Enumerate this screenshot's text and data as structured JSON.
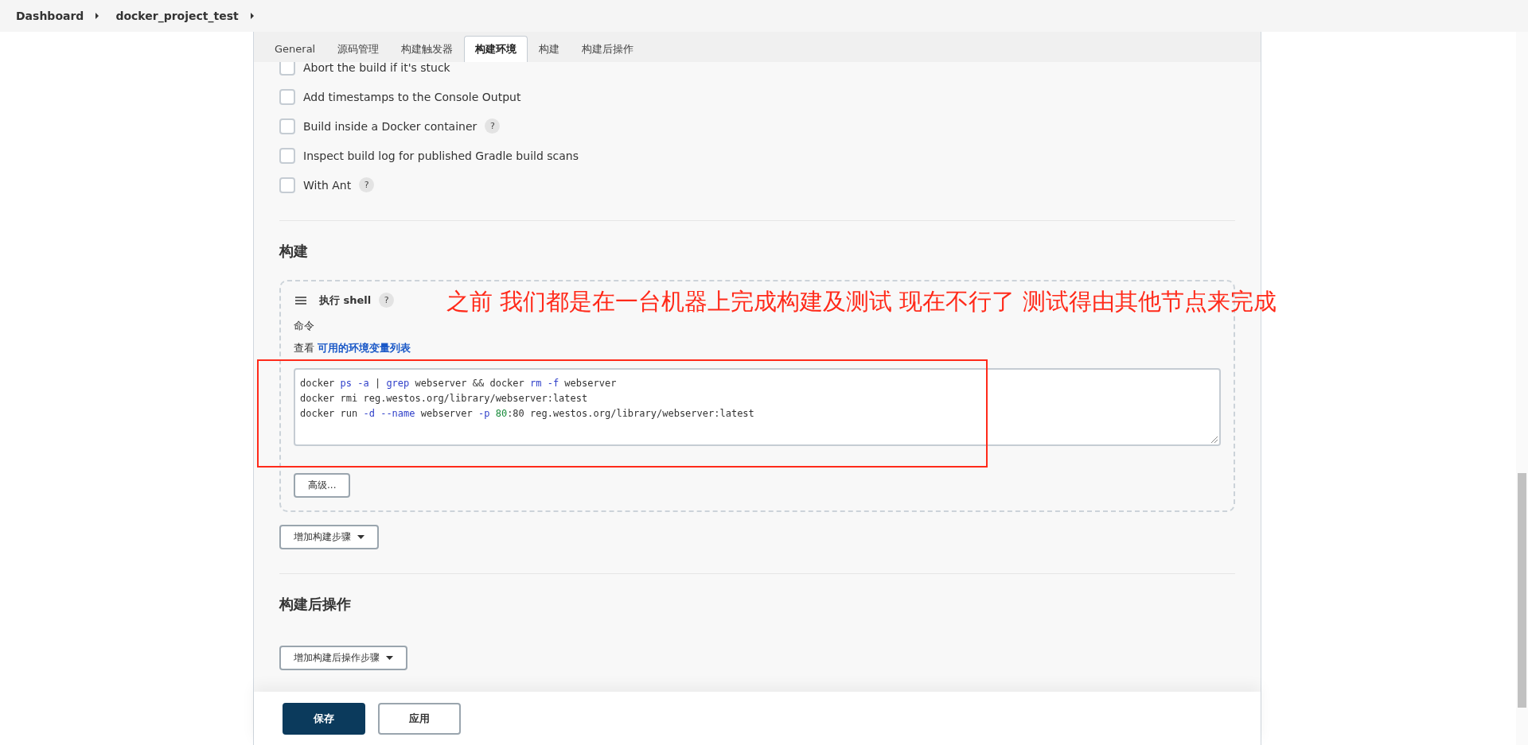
{
  "breadcrumbs": [
    "Dashboard",
    "docker_project_test"
  ],
  "tabs": [
    {
      "label": "General",
      "selected": false
    },
    {
      "label": "源码管理",
      "selected": false
    },
    {
      "label": "构建触发器",
      "selected": false
    },
    {
      "label": "构建环境",
      "selected": true
    },
    {
      "label": "构建",
      "selected": false
    },
    {
      "label": "构建后操作",
      "selected": false
    }
  ],
  "build_environment": [
    {
      "label": "Abort the build if it's stuck",
      "checked": false,
      "help": false
    },
    {
      "label": "Add timestamps to the Console Output",
      "checked": false,
      "help": false
    },
    {
      "label": "Build inside a Docker container",
      "checked": false,
      "help": true
    },
    {
      "label": "Inspect build log for published Gradle build scans",
      "checked": false,
      "help": false
    },
    {
      "label": "With Ant",
      "checked": false,
      "help": true
    }
  ],
  "help_mark": "?",
  "build": {
    "heading": "构建",
    "step": {
      "title": "执行 shell",
      "command_label": "命令",
      "env_prefix": "查看",
      "env_link": "可用的环境变量列表",
      "command_lines": [
        [
          {
            "kind": "plain",
            "text": "docker "
          },
          {
            "kind": "keyword",
            "text": "ps -a"
          },
          {
            "kind": "plain",
            "text": " | "
          },
          {
            "kind": "keyword",
            "text": "grep"
          },
          {
            "kind": "plain",
            "text": " webserver && docker "
          },
          {
            "kind": "keyword",
            "text": "rm -f"
          },
          {
            "kind": "plain",
            "text": " webserver"
          }
        ],
        [
          {
            "kind": "plain",
            "text": "docker rmi reg.westos.org/library/webserver:latest"
          }
        ],
        [
          {
            "kind": "plain",
            "text": "docker run "
          },
          {
            "kind": "keyword",
            "text": "-d --name"
          },
          {
            "kind": "plain",
            "text": " webserver "
          },
          {
            "kind": "keyword",
            "text": "-p"
          },
          {
            "kind": "number",
            "text": " 80"
          },
          {
            "kind": "plain",
            "text": ":80 reg.westos.org/library/webserver:latest"
          }
        ]
      ],
      "advanced_button": "高级..."
    },
    "add_step_button": "增加构建步骤"
  },
  "post_build": {
    "heading": "构建后操作",
    "add_step_button": "增加构建后操作步骤"
  },
  "footer_buttons": [
    {
      "label": "保存",
      "kind": "primary"
    },
    {
      "label": "应用",
      "kind": "secondary"
    }
  ],
  "annotation": {
    "text": "之前 我们都是在一台机器上完成构建及测试 现在不行了 测试得由其他节点来完成",
    "color": "#ff2a1a"
  }
}
